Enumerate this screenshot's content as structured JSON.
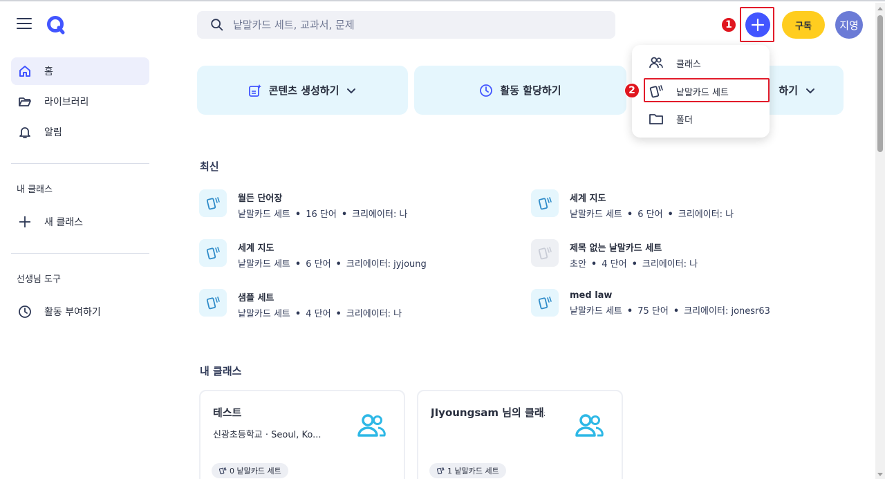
{
  "header": {
    "search_placeholder": "낱말카드 세트, 교과서, 문제",
    "subscribe_label": "구독",
    "avatar_text": "지영",
    "create_button_glyph": "+",
    "badge1": "1",
    "badge2": "2"
  },
  "sidebar": {
    "items": [
      {
        "label": "홈",
        "icon": "home-icon"
      },
      {
        "label": "라이브러리",
        "icon": "folder-open-icon"
      },
      {
        "label": "알림",
        "icon": "bell-icon"
      }
    ],
    "my_classes_heading": "내 클래스",
    "new_class_label": "새 클래스",
    "teacher_tools_heading": "선생님 도구",
    "assign_activity_label": "활동 부여하기"
  },
  "actions": {
    "create_content": "콘텐츠 생성하기",
    "assign_activity": "활동 할당하기",
    "third_partial": "하기"
  },
  "dropdown": {
    "items": [
      {
        "label": "클래스",
        "icon": "users-icon"
      },
      {
        "label": "낱말카드 세트",
        "icon": "flashcards-icon"
      },
      {
        "label": "폴더",
        "icon": "folder-icon"
      }
    ]
  },
  "recent": {
    "title": "최신",
    "items": [
      {
        "title": "월든 단어장",
        "type": "낱말카드 세트",
        "count": "16 단어",
        "creator": "크리에이터: 나"
      },
      {
        "title": "세계 지도",
        "type": "낱말카드 세트",
        "count": "6 단어",
        "creator": "크리에이터: 나"
      },
      {
        "title": "세계 지도",
        "type": "낱말카드 세트",
        "count": "6 단어",
        "creator": "크리에이터: jyjoung"
      },
      {
        "title": "제목 없는 낱말카드 세트",
        "type": "초안",
        "count": "4 단어",
        "creator": "크리에이터: 나"
      },
      {
        "title": "샘플 세트",
        "type": "낱말카드 세트",
        "count": "4 단어",
        "creator": "크리에이터: 나"
      },
      {
        "title": "med law",
        "type": "낱말카드 세트",
        "count": "75 단어",
        "creator": "크리에이터: jonesr63"
      }
    ],
    "dot": "•"
  },
  "my_classes": {
    "title": "내 클래스",
    "cards": [
      {
        "title": "테스트",
        "subtitle": "신광초등학교 · Seoul, Ko...",
        "sets": "0 낱말카드 세트"
      },
      {
        "title": "JIyoungsam 님의 클래스",
        "subtitle": "",
        "sets": "1 낱말카드 세트"
      }
    ]
  },
  "colors": {
    "brand": "#4255ff",
    "subscribe": "#ffcd1f",
    "action_bg": "#e5f6fd",
    "annotation_red": "#e21b2a",
    "icon_blue": "#2e8bc9"
  }
}
